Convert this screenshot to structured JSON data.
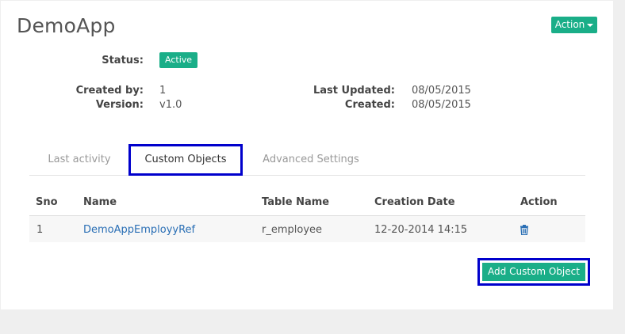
{
  "app": {
    "title": "DemoApp"
  },
  "header": {
    "action_label": "Action"
  },
  "details": {
    "status_label": "Status:",
    "status_value": "Active",
    "created_by_label": "Created by:",
    "created_by_value": "1",
    "version_label": "Version:",
    "version_value": "v1.0",
    "last_updated_label": "Last Updated:",
    "last_updated_value": "08/05/2015",
    "created_label": "Created:",
    "created_value": "08/05/2015"
  },
  "tabs": [
    {
      "label": "Last activity",
      "active": false
    },
    {
      "label": "Custom Objects",
      "active": true
    },
    {
      "label": "Advanced Settings",
      "active": false
    }
  ],
  "table": {
    "headers": [
      "Sno",
      "Name",
      "Table Name",
      "Creation Date",
      "Action"
    ],
    "rows": [
      {
        "sno": "1",
        "name": "DemoAppEmployyRef",
        "table_name": "r_employee",
        "creation_date": "12-20-2014 14:15",
        "action_icon": "trash-icon"
      }
    ]
  },
  "add_button": {
    "label": "Add Custom Object"
  },
  "colors": {
    "accent": "#1aae88",
    "highlight": "#0000cc",
    "link": "#2a6fb5"
  }
}
